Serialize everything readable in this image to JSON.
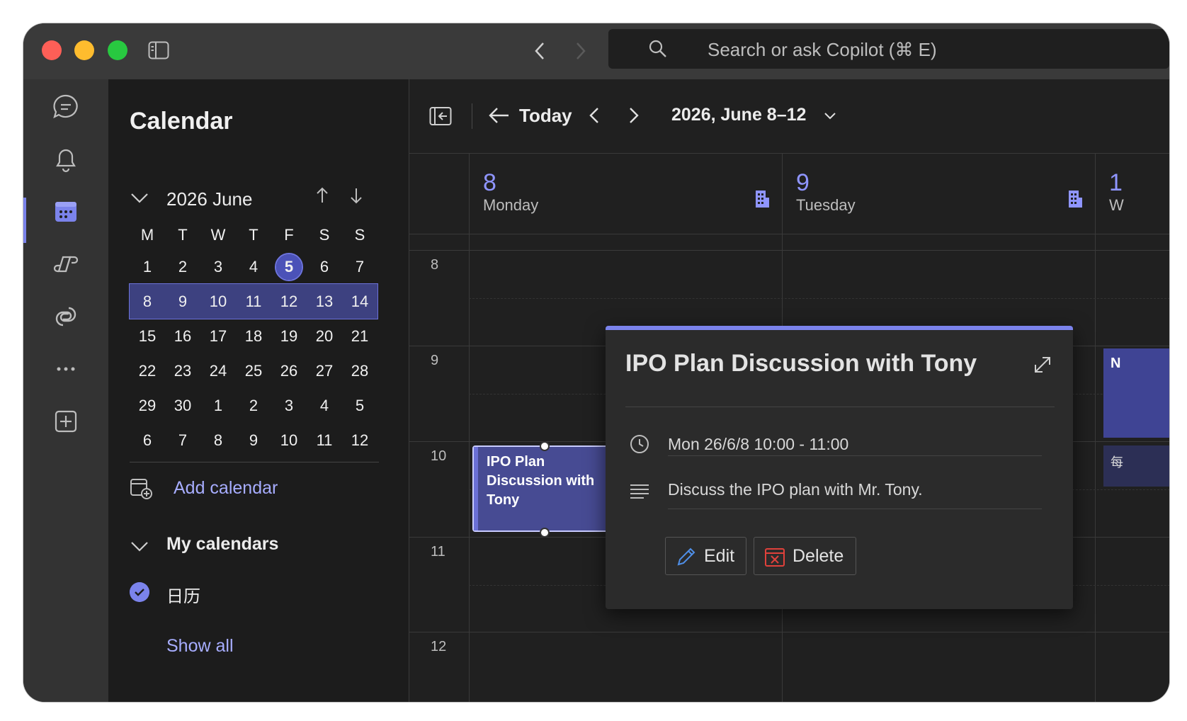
{
  "search": {
    "placeholder": "Search or ask Copilot (⌘ E)"
  },
  "sidebar": {
    "title": "Calendar",
    "mini_month": {
      "title": "2026 June",
      "weekdays": [
        "M",
        "T",
        "W",
        "T",
        "F",
        "S",
        "S"
      ],
      "weeks": [
        [
          "1",
          "2",
          "3",
          "4",
          "5",
          "6",
          "7"
        ],
        [
          "8",
          "9",
          "10",
          "11",
          "12",
          "13",
          "14"
        ],
        [
          "15",
          "16",
          "17",
          "18",
          "19",
          "20",
          "21"
        ],
        [
          "22",
          "23",
          "24",
          "25",
          "26",
          "27",
          "28"
        ],
        [
          "29",
          "30",
          "1",
          "2",
          "3",
          "4",
          "5"
        ],
        [
          "6",
          "7",
          "8",
          "9",
          "10",
          "11",
          "12"
        ]
      ],
      "today": "5",
      "selected_week_index": 1
    },
    "add_calendar": "Add calendar",
    "my_calendars": "My calendars",
    "calendar_item": "日历",
    "show_all": "Show all"
  },
  "toolbar": {
    "today": "Today",
    "range": "2026, June 8–12"
  },
  "days": [
    {
      "num": "8",
      "name": "Monday"
    },
    {
      "num": "9",
      "name": "Tuesday"
    },
    {
      "num": "1",
      "name": "W"
    }
  ],
  "hours": [
    "8",
    "9",
    "10",
    "11",
    "12"
  ],
  "event": {
    "title": "IPO Plan Discussion with Tony"
  },
  "side_events": {
    "first": "N",
    "second": "每"
  },
  "popup": {
    "title": "IPO Plan Discussion with Tony",
    "time": "Mon 26/6/8 10:00 - 11:00",
    "description": "Discuss the IPO plan with Mr. Tony.",
    "edit": "Edit",
    "delete": "Delete"
  },
  "colors": {
    "accent": "#7b83eb",
    "event_bg": "#474b93",
    "delete_red": "#e0413b"
  }
}
